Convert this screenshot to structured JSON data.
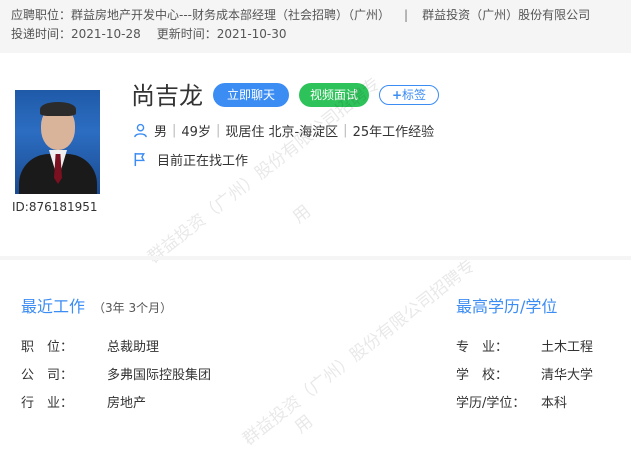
{
  "header": {
    "position_label": "应聘职位：",
    "position_value": "群益房地产开发中心---财务成本部经理（社会招聘）（广州）",
    "separator": "|",
    "company": "群益投资（广州）股份有限公司",
    "delivered_label": "投递时间：",
    "delivered_value": "2021-10-28",
    "updated_label": "更新时间：",
    "updated_value": "2021-10-30"
  },
  "candidate": {
    "name": "尚吉龙",
    "resume_id": "ID:876181951",
    "gender": "男",
    "age": "49岁",
    "residence": "现居住 北京-海淀区",
    "experience": "25年工作经验",
    "job_status": "目前正在找工作"
  },
  "actions": {
    "chat_label": "立即聊天",
    "video_label": "视频面试",
    "tag_label": "标签"
  },
  "recent_work": {
    "title": "最近工作",
    "duration": "（3年 3个月）",
    "fields": [
      {
        "label": "职　位：",
        "value": "总裁助理"
      },
      {
        "label": "公　司：",
        "value": "多弗国际控股集团"
      },
      {
        "label": "行　业：",
        "value": "房地产"
      }
    ]
  },
  "education": {
    "title": "最高学历/学位",
    "fields": [
      {
        "label": "专　业：",
        "value": "土木工程"
      },
      {
        "label": "学　校：",
        "value": "清华大学"
      },
      {
        "label": "学历/学位：",
        "value": "本科"
      }
    ]
  },
  "watermark": {
    "line1": "群益投资（广州）股份有限公司招聘专",
    "line2": "用"
  },
  "colors": {
    "accent": "#3b8cf3",
    "video": "#2ec25a"
  }
}
